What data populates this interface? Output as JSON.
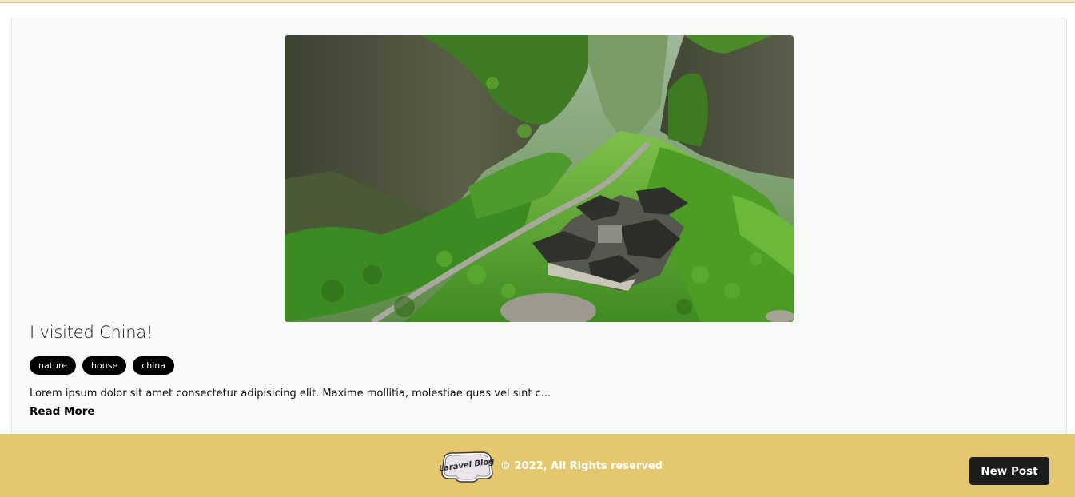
{
  "post": {
    "image_alt": "Green canyon with traditional Chinese courtyard houses",
    "title": "I visited China!",
    "tags": [
      "nature",
      "house",
      "china"
    ],
    "excerpt": "Lorem ipsum dolor sit amet consectetur adipisicing elit. Maxime mollitia, molestiae quas vel sint c...",
    "read_more_label": "Read More"
  },
  "footer": {
    "logo_text": "Laravel Blog",
    "copyright": "© 2022, All Rights reserved",
    "new_post_label": "New Post"
  },
  "colors": {
    "top_strip": "#fbe2c2",
    "card_bg": "#f8f9fb",
    "tag_bg": "#000000",
    "footer_bg": "#e4c76e",
    "button_bg": "#1c1c1c"
  }
}
